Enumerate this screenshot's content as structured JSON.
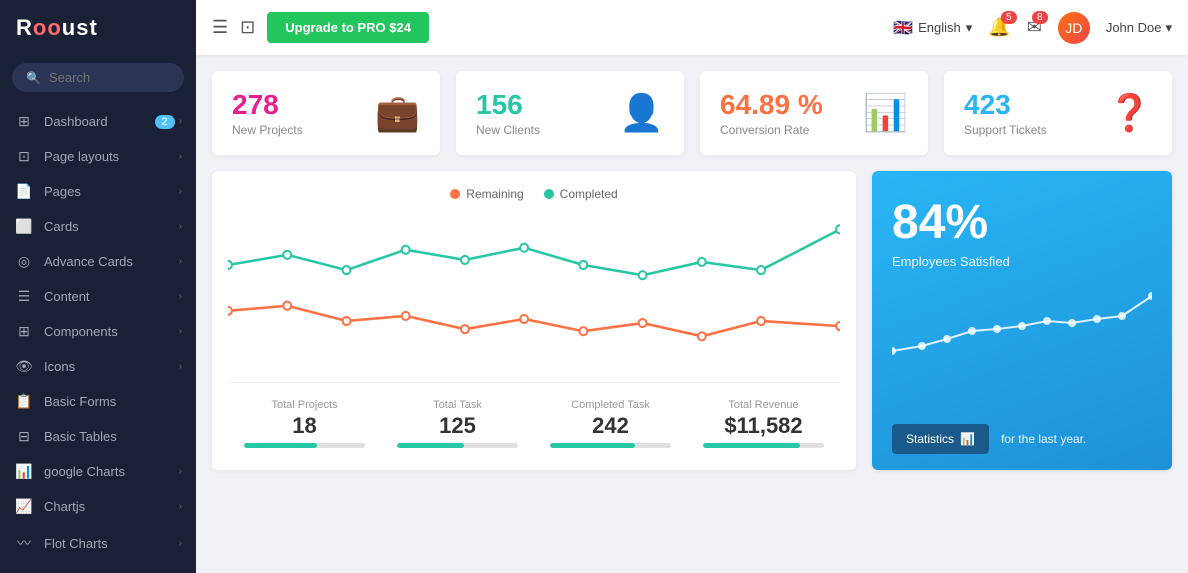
{
  "sidebar": {
    "logo": "Rooust",
    "logo_highlight": "oo",
    "search_placeholder": "Search",
    "items": [
      {
        "id": "dashboard",
        "label": "Dashboard",
        "icon": "⊞",
        "badge": "2",
        "arrow": true
      },
      {
        "id": "page-layouts",
        "label": "Page layouts",
        "icon": "⊡",
        "arrow": true
      },
      {
        "id": "pages",
        "label": "Pages",
        "icon": "📄",
        "arrow": true
      },
      {
        "id": "cards",
        "label": "Cards",
        "icon": "⬜",
        "arrow": true
      },
      {
        "id": "advance-cards",
        "label": "Advance Cards",
        "icon": "◎",
        "arrow": true
      },
      {
        "id": "content",
        "label": "Content",
        "icon": "☰",
        "arrow": true
      },
      {
        "id": "components",
        "label": "Components",
        "icon": "⊞",
        "arrow": true
      },
      {
        "id": "icons",
        "label": "Icons",
        "icon": "👁",
        "arrow": true
      },
      {
        "id": "basic-forms",
        "label": "Basic Forms",
        "icon": "📋",
        "arrow": false
      },
      {
        "id": "basic-tables",
        "label": "Basic Tables",
        "icon": "⊟",
        "arrow": false
      },
      {
        "id": "google-charts",
        "label": "google Charts",
        "icon": "📊",
        "arrow": true
      },
      {
        "id": "chartjs",
        "label": "Chartjs",
        "icon": "📈",
        "arrow": true
      },
      {
        "id": "flot-charts",
        "label": "Flot Charts",
        "icon": "〰",
        "arrow": true
      }
    ]
  },
  "topbar": {
    "upgrade_btn": "Upgrade to PRO $24",
    "language": "English",
    "notif_count": "5",
    "mail_count": "8",
    "user_name": "John Doe"
  },
  "stats": [
    {
      "id": "new-projects",
      "value": "278",
      "label": "New Projects",
      "icon": "💼",
      "theme": "pink"
    },
    {
      "id": "new-clients",
      "value": "156",
      "label": "New Clients",
      "icon": "👤",
      "theme": "teal"
    },
    {
      "id": "conversion-rate",
      "value": "64.89 %",
      "label": "Conversion Rate",
      "icon": "📊",
      "theme": "orange"
    },
    {
      "id": "support-tickets",
      "value": "423",
      "label": "Support Tickets",
      "icon": "❓",
      "theme": "blue"
    }
  ],
  "chart": {
    "legend": {
      "remaining": "Remaining",
      "completed": "Completed"
    },
    "stats": [
      {
        "label": "Total Projects",
        "value": "18",
        "fill": 60
      },
      {
        "label": "Total Task",
        "value": "125",
        "fill": 55
      },
      {
        "label": "Completed Task",
        "value": "242",
        "fill": 70
      },
      {
        "label": "Total Revenue",
        "value": "$11,582",
        "fill": 80
      }
    ]
  },
  "right_panel": {
    "percent": "84%",
    "label": "Employees Satisfied",
    "btn_label": "Statistics",
    "footer_text": "for the last year."
  }
}
